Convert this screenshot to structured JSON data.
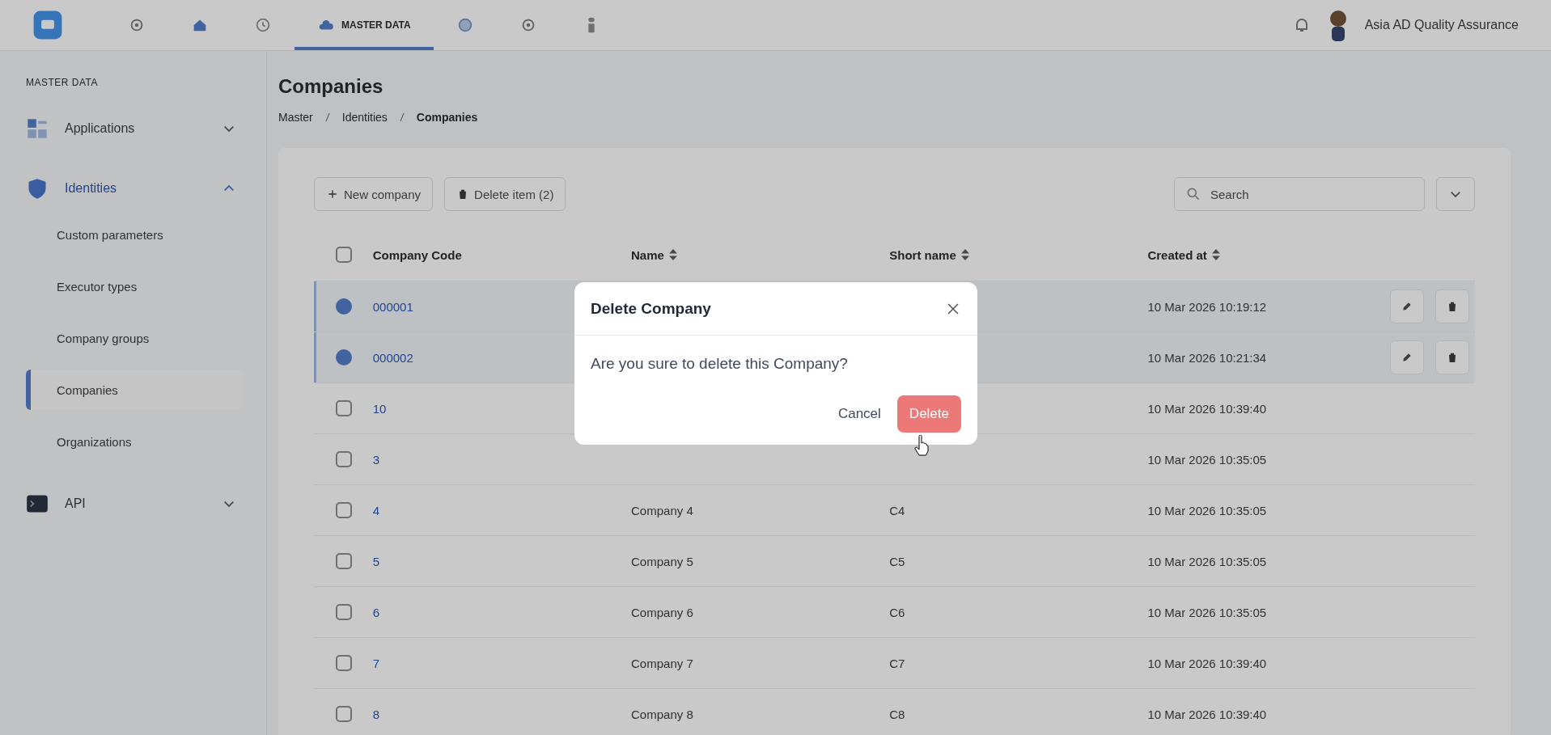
{
  "topbar": {
    "nav": [
      {
        "kind": "logo",
        "selected": false
      },
      {
        "kind": "gear",
        "selected": false
      },
      {
        "kind": "home",
        "selected": false
      },
      {
        "kind": "clock",
        "selected": false
      },
      {
        "kind": "cloud",
        "label": "MASTER DATA",
        "selected": true
      },
      {
        "kind": "globe",
        "selected": false
      },
      {
        "kind": "gear",
        "selected": false
      },
      {
        "kind": "info",
        "selected": false
      }
    ],
    "user": {
      "name": "Asia AD Quality Assurance"
    }
  },
  "sidebar": {
    "heading": "MASTER DATA",
    "items": [
      {
        "label": "Applications",
        "kind": "apps",
        "expanded": false,
        "selected": false
      },
      {
        "label": "Identities",
        "kind": "shield",
        "expanded": true,
        "selected": true,
        "children": [
          {
            "label": "Custom parameters",
            "selected": false
          },
          {
            "label": "Executor types",
            "selected": false
          },
          {
            "label": "Company groups",
            "selected": false
          },
          {
            "label": "Companies",
            "selected": true
          },
          {
            "label": "Organizations",
            "selected": false
          }
        ]
      },
      {
        "label": "API",
        "kind": "terminal",
        "expanded": false,
        "selected": false
      }
    ]
  },
  "page": {
    "title": "Companies",
    "breadcrumb": [
      "Master",
      "Identities",
      "Companies"
    ]
  },
  "toolbar": {
    "buttons": [
      {
        "label": "New company",
        "kind": "plus"
      },
      {
        "label": "Delete item (2)",
        "kind": "trash"
      }
    ],
    "search": {
      "placeholder": "Search"
    }
  },
  "table": {
    "select_all": {
      "checked": false
    },
    "columns": [
      {
        "label": "Company Code",
        "sortable": false
      },
      {
        "label": "Name",
        "sortable": true
      },
      {
        "label": "Short name",
        "sortable": true
      },
      {
        "label": "Created at",
        "sortable": true
      }
    ],
    "rows": [
      {
        "selected": true,
        "code": "000001",
        "created": "10 Mar 2026 10:19:12"
      },
      {
        "selected": true,
        "code": "000002",
        "created": "10 Mar 2026 10:21:34"
      },
      {
        "selected": false,
        "code": "10",
        "created": "10 Mar 2026 10:39:40"
      },
      {
        "selected": false,
        "code": "3",
        "created": "10 Mar 2026 10:35:05"
      },
      {
        "selected": false,
        "code": "4",
        "name": "Company 4",
        "short": "C4",
        "created": "10 Mar 2026 10:35:05"
      },
      {
        "selected": false,
        "code": "5",
        "name": "Company 5",
        "short": "C5",
        "created": "10 Mar 2026 10:35:05"
      },
      {
        "selected": false,
        "code": "6",
        "name": "Company 6",
        "short": "C6",
        "created": "10 Mar 2026 10:35:05"
      },
      {
        "selected": false,
        "code": "7",
        "name": "Company 7",
        "short": "C7",
        "created": "10 Mar 2026 10:39:40"
      },
      {
        "selected": false,
        "code": "8",
        "name": "Company 8",
        "short": "C8",
        "created": "10 Mar 2026 10:39:40"
      }
    ]
  },
  "dialog": {
    "title": "Delete Company",
    "message": "Are you sure to delete this Company?",
    "buttons": [
      {
        "label": "Cancel",
        "kind": "text"
      },
      {
        "label": "Delete",
        "kind": "danger"
      }
    ]
  }
}
